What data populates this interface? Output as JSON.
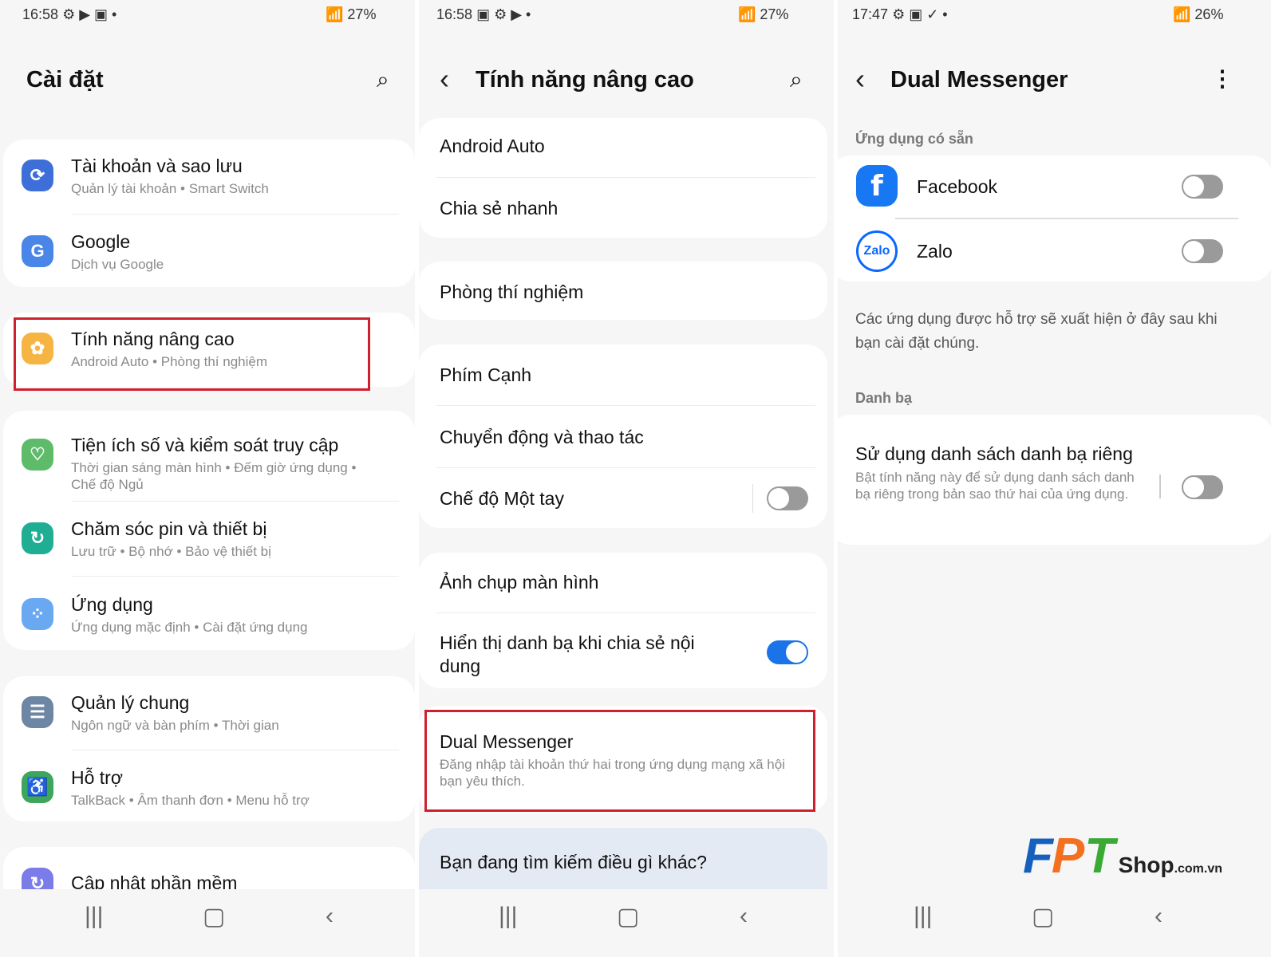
{
  "screens": [
    {
      "status": {
        "time": "16:58",
        "icons": "⚙ ▶ ▣ •",
        "battery": "27%"
      },
      "title": "Cài đặt",
      "items": [
        {
          "title": "Tài khoản và sao lưu",
          "sub": "Quản lý tài khoản  •  Smart Switch",
          "icon": "sync-icon",
          "color": "#3e6fd8"
        },
        {
          "title": "Google",
          "sub": "Dịch vụ Google",
          "icon": "google-icon",
          "color": "#4a86e8"
        },
        {
          "title": "Tính năng nâng cao",
          "sub": "Android Auto  •  Phòng thí nghiệm",
          "icon": "gear-plus-icon",
          "color": "#f6b443"
        },
        {
          "title": "Tiện ích số và kiểm soát truy cập",
          "sub": "Thời gian sáng màn hình  •  Đếm giờ ứng dụng  •  Chế độ Ngủ",
          "icon": "wellbeing-icon",
          "color": "#5dbb6a"
        },
        {
          "title": "Chăm sóc pin và thiết bị",
          "sub": "Lưu trữ  •  Bộ nhớ  •  Bảo vệ thiết bị",
          "icon": "device-care-icon",
          "color": "#1fae94"
        },
        {
          "title": "Ứng dụng",
          "sub": "Ứng dụng mặc định  •  Cài đặt ứng dụng",
          "icon": "apps-icon",
          "color": "#6aa9f2"
        },
        {
          "title": "Quản lý chung",
          "sub": "Ngôn ngữ và bàn phím  •  Thời gian",
          "icon": "sliders-icon",
          "color": "#6d86a3"
        },
        {
          "title": "Hỗ trợ",
          "sub": "TalkBack  •  Âm thanh đơn  •  Menu hỗ trợ",
          "icon": "accessibility-icon",
          "color": "#3ea55c"
        },
        {
          "title": "Cập nhật phần mềm",
          "icon": "update-icon",
          "color": "#7b7ce8"
        }
      ]
    },
    {
      "status": {
        "time": "16:58",
        "icons": "▣ ⚙ ▶ •",
        "battery": "27%"
      },
      "title": "Tính năng nâng cao",
      "items": [
        {
          "title": "Android Auto"
        },
        {
          "title": "Chia sẻ nhanh"
        },
        {
          "title": "Phòng thí nghiệm"
        },
        {
          "title": "Phím Cạnh"
        },
        {
          "title": "Chuyển động và thao tác"
        },
        {
          "title": "Chế độ Một tay",
          "toggle": false
        },
        {
          "title": "Ảnh chụp màn hình"
        },
        {
          "title": "Hiển thị danh bạ khi chia sẻ nội dung",
          "toggle": true
        },
        {
          "title": "Dual Messenger",
          "sub": "Đăng nhập tài khoản thứ hai trong ứng dụng mạng xã hội bạn yêu thích."
        }
      ],
      "search_prompt": "Bạn đang tìm kiếm điều gì khác?"
    },
    {
      "status": {
        "time": "17:47",
        "icons": "⚙ ▣ ✓ •",
        "battery": "26%"
      },
      "title": "Dual Messenger",
      "section1": "Ứng dụng có sẵn",
      "apps": [
        {
          "name": "Facebook",
          "toggle": false,
          "logo": "f"
        },
        {
          "name": "Zalo",
          "toggle": false,
          "logo": "Zalo"
        }
      ],
      "note": "Các ứng dụng được hỗ trợ sẽ xuất hiện ở đây sau khi bạn cài đặt chúng.",
      "section2": "Danh bạ",
      "contacts": {
        "title": "Sử dụng danh sách danh bạ riêng",
        "sub": "Bật tính năng này để sử dụng danh sách danh bạ riêng trong bản sao thứ hai của ứng dụng.",
        "toggle": false
      }
    }
  ],
  "watermark": {
    "logo": "FPT",
    "text": "Shop",
    "suffix": ".com.vn"
  },
  "colors": {
    "highlight": "#d0202e",
    "accent": "#1a73e8"
  }
}
